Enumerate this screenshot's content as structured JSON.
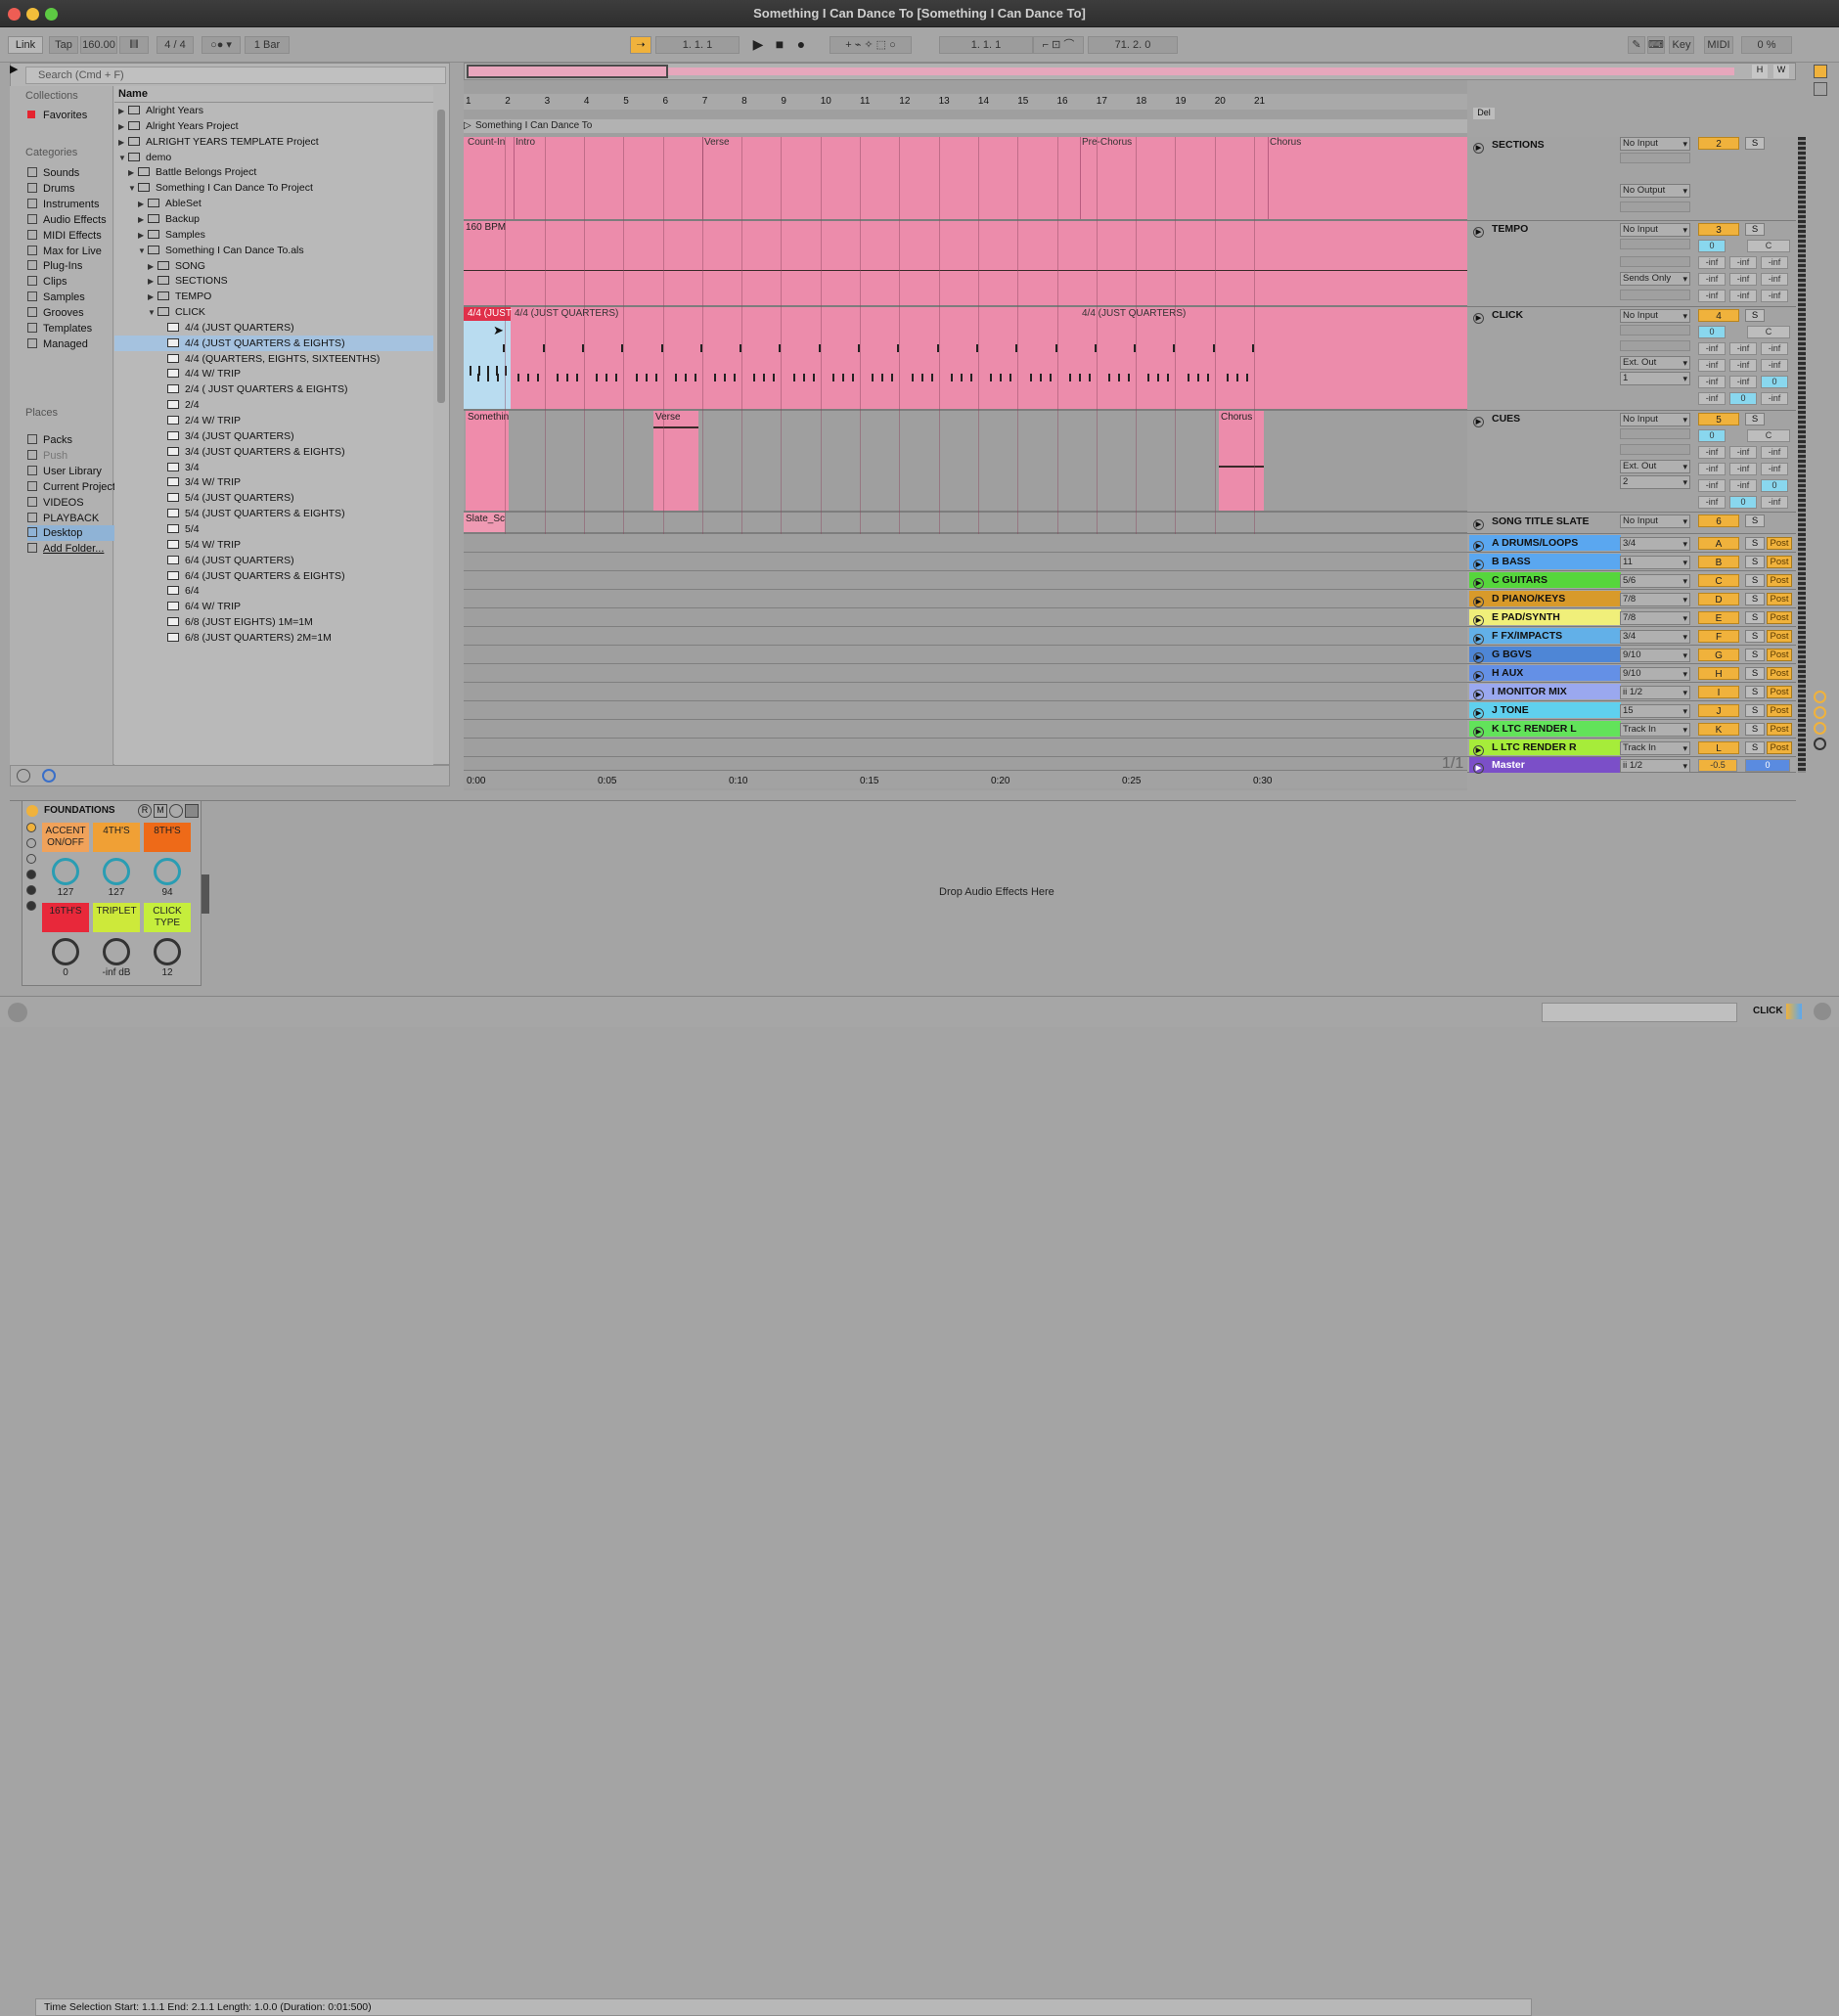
{
  "window": {
    "title": "Something I Can Dance To  [Something I Can Dance To]"
  },
  "control_bar": {
    "link": "Link",
    "tap": "Tap",
    "tempo": "160.00",
    "time_sig": "4 / 4",
    "quantize": "1 Bar",
    "arr_pos": "1.   1.   1",
    "loop_start": "1.   1.   1",
    "loop_len": "71.   2.   0",
    "key": "Key",
    "midi": "MIDI",
    "cpu": "0 %"
  },
  "browser": {
    "search_placeholder": "Search (Cmd + F)",
    "collections_header": "Collections",
    "favorites": "Favorites",
    "categories_header": "Categories",
    "categories": [
      "Sounds",
      "Drums",
      "Instruments",
      "Audio Effects",
      "MIDI Effects",
      "Max for Live",
      "Plug-Ins",
      "Clips",
      "Samples",
      "Grooves",
      "Templates",
      "Managed"
    ],
    "places_header": "Places",
    "places": [
      "Packs",
      "Push",
      "User Library",
      "Current Project",
      "VIDEOS",
      "PLAYBACK PRO",
      "Desktop",
      "Add Folder..."
    ],
    "name_header": "Name",
    "items": [
      {
        "label": "Alright Years",
        "depth": 0,
        "arrow": "▶",
        "type": "folder"
      },
      {
        "label": "Alright Years Project",
        "depth": 0,
        "arrow": "▶",
        "type": "folder"
      },
      {
        "label": "ALRIGHT YEARS TEMPLATE Project",
        "depth": 0,
        "arrow": "▶",
        "type": "folder"
      },
      {
        "label": "demo",
        "depth": 0,
        "arrow": "▼",
        "type": "folder"
      },
      {
        "label": "Battle Belongs Project",
        "depth": 1,
        "arrow": "▶",
        "type": "folder"
      },
      {
        "label": "Something I Can Dance To Project",
        "depth": 1,
        "arrow": "▼",
        "type": "folder"
      },
      {
        "label": "AbleSet",
        "depth": 2,
        "arrow": "▶",
        "type": "folder"
      },
      {
        "label": "Backup",
        "depth": 2,
        "arrow": "▶",
        "type": "folder"
      },
      {
        "label": "Samples",
        "depth": 2,
        "arrow": "▶",
        "type": "folder"
      },
      {
        "label": "Something I Can Dance To.als",
        "depth": 2,
        "arrow": "▼",
        "type": "file"
      },
      {
        "label": "SONG",
        "depth": 3,
        "arrow": "▶",
        "type": "track"
      },
      {
        "label": "SECTIONS",
        "depth": 3,
        "arrow": "▶",
        "type": "track"
      },
      {
        "label": "TEMPO",
        "depth": 3,
        "arrow": "▶",
        "type": "track"
      },
      {
        "label": "CLICK",
        "depth": 3,
        "arrow": "▼",
        "type": "track"
      },
      {
        "label": "4/4 (JUST QUARTERS)",
        "depth": 4,
        "arrow": "",
        "type": "clip"
      },
      {
        "label": "4/4 (JUST QUARTERS & EIGHTS)",
        "depth": 4,
        "arrow": "",
        "type": "clip",
        "sel": true
      },
      {
        "label": "4/4 (QUARTERS, EIGHTS, SIXTEENTHS)",
        "depth": 4,
        "arrow": "",
        "type": "clip"
      },
      {
        "label": "4/4  W/ TRIP",
        "depth": 4,
        "arrow": "",
        "type": "clip"
      },
      {
        "label": "2/4 ( JUST QUARTERS & EIGHTS)",
        "depth": 4,
        "arrow": "",
        "type": "clip"
      },
      {
        "label": "2/4",
        "depth": 4,
        "arrow": "",
        "type": "clip"
      },
      {
        "label": "2/4 W/ TRIP",
        "depth": 4,
        "arrow": "",
        "type": "clip"
      },
      {
        "label": "3/4 (JUST QUARTERS)",
        "depth": 4,
        "arrow": "",
        "type": "clip"
      },
      {
        "label": "3/4 (JUST QUARTERS & EIGHTS)",
        "depth": 4,
        "arrow": "",
        "type": "clip"
      },
      {
        "label": "3/4",
        "depth": 4,
        "arrow": "",
        "type": "clip"
      },
      {
        "label": "3/4  W/ TRIP",
        "depth": 4,
        "arrow": "",
        "type": "clip"
      },
      {
        "label": "5/4 (JUST QUARTERS)",
        "depth": 4,
        "arrow": "",
        "type": "clip"
      },
      {
        "label": "5/4 (JUST QUARTERS & EIGHTS)",
        "depth": 4,
        "arrow": "",
        "type": "clip"
      },
      {
        "label": "5/4",
        "depth": 4,
        "arrow": "",
        "type": "clip"
      },
      {
        "label": "5/4  W/ TRIP",
        "depth": 4,
        "arrow": "",
        "type": "clip"
      },
      {
        "label": "6/4 (JUST QUARTERS)",
        "depth": 4,
        "arrow": "",
        "type": "clip"
      },
      {
        "label": "6/4 (JUST QUARTERS & EIGHTS)",
        "depth": 4,
        "arrow": "",
        "type": "clip"
      },
      {
        "label": "6/4",
        "depth": 4,
        "arrow": "",
        "type": "clip"
      },
      {
        "label": "6/4 W/ TRIP",
        "depth": 4,
        "arrow": "",
        "type": "clip"
      },
      {
        "label": "6/8 (JUST EIGHTS) 1M=1M",
        "depth": 4,
        "arrow": "",
        "type": "clip"
      },
      {
        "label": "6/8 (JUST QUARTERS) 2M=1M",
        "depth": 4,
        "arrow": "",
        "type": "clip"
      }
    ]
  },
  "arrangement": {
    "ruler": [
      "1",
      "2",
      "3",
      "4",
      "5",
      "6",
      "7",
      "8",
      "9",
      "10",
      "11",
      "12",
      "13",
      "14",
      "15",
      "16",
      "17",
      "18",
      "19",
      "20",
      "21"
    ],
    "locator": "Something I Can Dance To",
    "del": "Del",
    "page": "1/1",
    "times": [
      "0:00",
      "0:05",
      "0:10",
      "0:15",
      "0:20",
      "0:25",
      "0:30"
    ],
    "sections_clips": [
      "Count-In",
      "Intro",
      "Verse",
      "Pre-Chorus",
      "Chorus"
    ],
    "tempo_clip": "160 BPM",
    "click_clips": [
      "4/4 (JUST",
      "4/4 (JUST QUARTERS)",
      "4/4 (JUST QUARTERS)"
    ],
    "cues_clips": [
      "Somethin",
      "Verse",
      "Chorus"
    ],
    "slate_clip": "Slate_Sc"
  },
  "mixer": {
    "sections": {
      "name": "SECTIONS",
      "in": "No Input",
      "out": "No Output",
      "num": "2",
      "s": "S"
    },
    "tempo": {
      "name": "TEMPO",
      "in": "No Input",
      "out": "Sends Only",
      "num": "3",
      "s": "S",
      "pan": "0",
      "c": "C",
      "inf": "-inf"
    },
    "click": {
      "name": "CLICK",
      "in": "No Input",
      "out": "Ext. Out",
      "ch": "1",
      "num": "4",
      "s": "S",
      "pan": "0",
      "c": "C",
      "z": "0"
    },
    "cues": {
      "name": "CUES",
      "in": "No Input",
      "out": "Ext. Out",
      "ch": "2",
      "num": "5",
      "s": "S",
      "pan": "0",
      "c": "C",
      "z": "0"
    },
    "slate": {
      "name": "SONG TITLE SLATE",
      "in": "No Input",
      "num": "6",
      "s": "S"
    },
    "groups": [
      {
        "name": "A DRUMS/LOOPS",
        "route": "3/4",
        "num": "A",
        "color": "#5aa7f0"
      },
      {
        "name": "B BASS",
        "route": "11",
        "num": "B",
        "color": "#5aa7f0"
      },
      {
        "name": "C GUITARS",
        "route": "5/6",
        "num": "C",
        "color": "#56d63c"
      },
      {
        "name": "D PIANO/KEYS",
        "route": "7/8",
        "num": "D",
        "color": "#d89a2a"
      },
      {
        "name": "E PAD/SYNTH",
        "route": "7/8",
        "num": "E",
        "color": "#f0ef7a"
      },
      {
        "name": "F FX/IMPACTS",
        "route": "3/4",
        "num": "F",
        "color": "#62b0e8"
      },
      {
        "name": "G BGVS",
        "route": "9/10",
        "num": "G",
        "color": "#4e86d6"
      },
      {
        "name": "H AUX",
        "route": "9/10",
        "num": "H",
        "color": "#6490e6"
      },
      {
        "name": "I MONITOR MIX",
        "route": "ii 1/2",
        "num": "I",
        "color": "#9aa8ef"
      },
      {
        "name": "J TONE",
        "route": "15",
        "num": "J",
        "color": "#5fd0ee"
      },
      {
        "name": "K LTC RENDER L",
        "route": "Track In",
        "num": "K",
        "color": "#62e35a"
      },
      {
        "name": "L LTC RENDER R",
        "route": "Track In",
        "num": "L",
        "color": "#a6ec3a"
      }
    ],
    "post": "Post",
    "master": {
      "name": "Master",
      "route": "ii 1/2",
      "vol": "-0.5",
      "pan": "0",
      "color": "#7b4fc8"
    }
  },
  "device": {
    "rack_name": "FOUNDATIONS",
    "r": "R",
    "m": "M",
    "pads": [
      {
        "label": "ACCENT ON/OFF",
        "value": "127",
        "color": "#f0a25a"
      },
      {
        "label": "4TH'S",
        "value": "127",
        "color": "#f0a035"
      },
      {
        "label": "8TH'S",
        "value": "94",
        "color": "#ee6a18"
      },
      {
        "label": "16TH'S",
        "value": "0",
        "color": "#e8283a"
      },
      {
        "label": "TRIPLET",
        "value": "-inf dB",
        "color": "#cde93a"
      },
      {
        "label": "CLICK TYPE",
        "value": "12",
        "color": "#c5ee3c"
      }
    ],
    "drop": "Drop Audio Effects Here"
  },
  "status": {
    "text": "Time Selection   Start: 1.1.1    End: 2.1.1    Length: 1.0.0  (Duration: 0:01:500)",
    "track": "CLICK"
  }
}
